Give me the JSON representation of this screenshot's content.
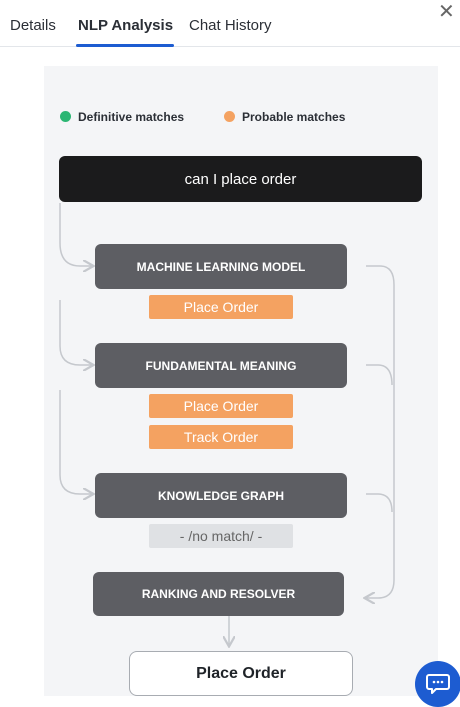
{
  "tabs": [
    {
      "label": "Details"
    },
    {
      "label": "NLP Analysis"
    },
    {
      "label": "Chat History"
    }
  ],
  "legend": {
    "definitive": {
      "label": "Definitive matches",
      "color": "#2bb673"
    },
    "probable": {
      "label": "Probable matches",
      "color": "#f4a261"
    }
  },
  "query": "can I place order",
  "engines": [
    {
      "label": "MACHINE LEARNING MODEL",
      "matches": [
        "Place Order"
      ]
    },
    {
      "label": "FUNDAMENTAL MEANING",
      "matches": [
        "Place Order",
        "Track Order"
      ]
    },
    {
      "label": "KNOWLEDGE GRAPH",
      "matches": [
        "- /no match/ -"
      ]
    }
  ],
  "resolver": {
    "label": "RANKING AND RESOLVER"
  },
  "final_result": "Place Order",
  "icons": {
    "close": "close-icon",
    "chat": "chat-icon"
  }
}
